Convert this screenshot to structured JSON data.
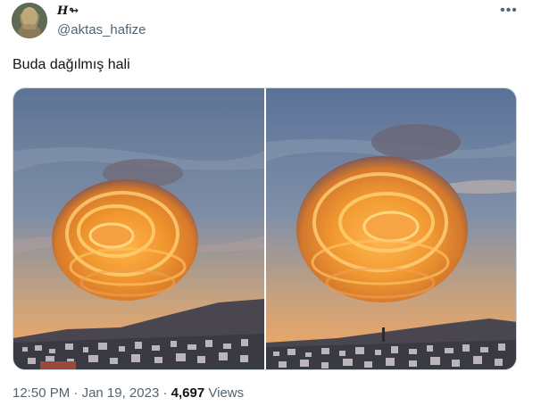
{
  "author": {
    "display_name": "H↬",
    "handle": "@aktas_hafize",
    "avatar": "profile-photo"
  },
  "menu_icon": "more-horizontal-icon",
  "menu_glyph": "•••",
  "tweet": {
    "text": "Buda dağılmış hali"
  },
  "media": {
    "count": 2,
    "items": [
      "lenticular-cloud-photo-1",
      "lenticular-cloud-photo-2"
    ]
  },
  "meta": {
    "time": "12:50 PM",
    "separator1": "·",
    "date": "Jan 19, 2023",
    "separator2": "·",
    "views_count": "4,697",
    "views_label": "Views"
  },
  "colors": {
    "text_primary": "#0f1419",
    "text_secondary": "#536471",
    "border": "#cfd9de"
  }
}
